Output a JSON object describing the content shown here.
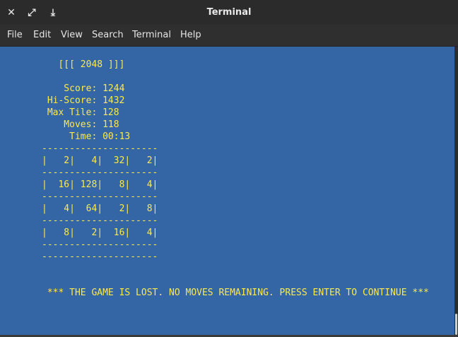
{
  "window": {
    "title": "Terminal",
    "close_glyph": "✕",
    "maximize_glyph": "⤢",
    "download_glyph": "⤓"
  },
  "menu": [
    "File",
    "Edit",
    "View",
    "Search",
    "Terminal",
    "Help"
  ],
  "terminal": {
    "bg_color": "#3465a4",
    "fg_color": "#fce94f",
    "lines": [
      "   [[[ 2048 ]]]",
      "",
      "    Score: 1244",
      " Hi-Score: 1432",
      " Max Tile: 128",
      "    Moves: 118",
      "     Time: 00:13",
      "---------------------",
      "|   2|   4|  32|   2|",
      "---------------------",
      "|  16| 128|   8|   4|",
      "---------------------",
      "|   4|  64|   2|   8|",
      "---------------------",
      "|   8|   2|  16|   4|",
      "---------------------",
      "---------------------",
      "",
      "",
      " *** THE GAME IS LOST. NO MOVES REMAINING. PRESS ENTER TO CONTINUE ***"
    ]
  },
  "game": {
    "title": "[[[ 2048 ]]]",
    "score": 1244,
    "hi_score": 1432,
    "max_tile": 128,
    "moves": 118,
    "time": "00:13",
    "board": [
      [
        2,
        4,
        32,
        2
      ],
      [
        16,
        128,
        8,
        4
      ],
      [
        4,
        64,
        2,
        8
      ],
      [
        8,
        2,
        16,
        4
      ]
    ],
    "status": "*** THE GAME IS LOST. NO MOVES REMAINING. PRESS ENTER TO CONTINUE ***"
  }
}
